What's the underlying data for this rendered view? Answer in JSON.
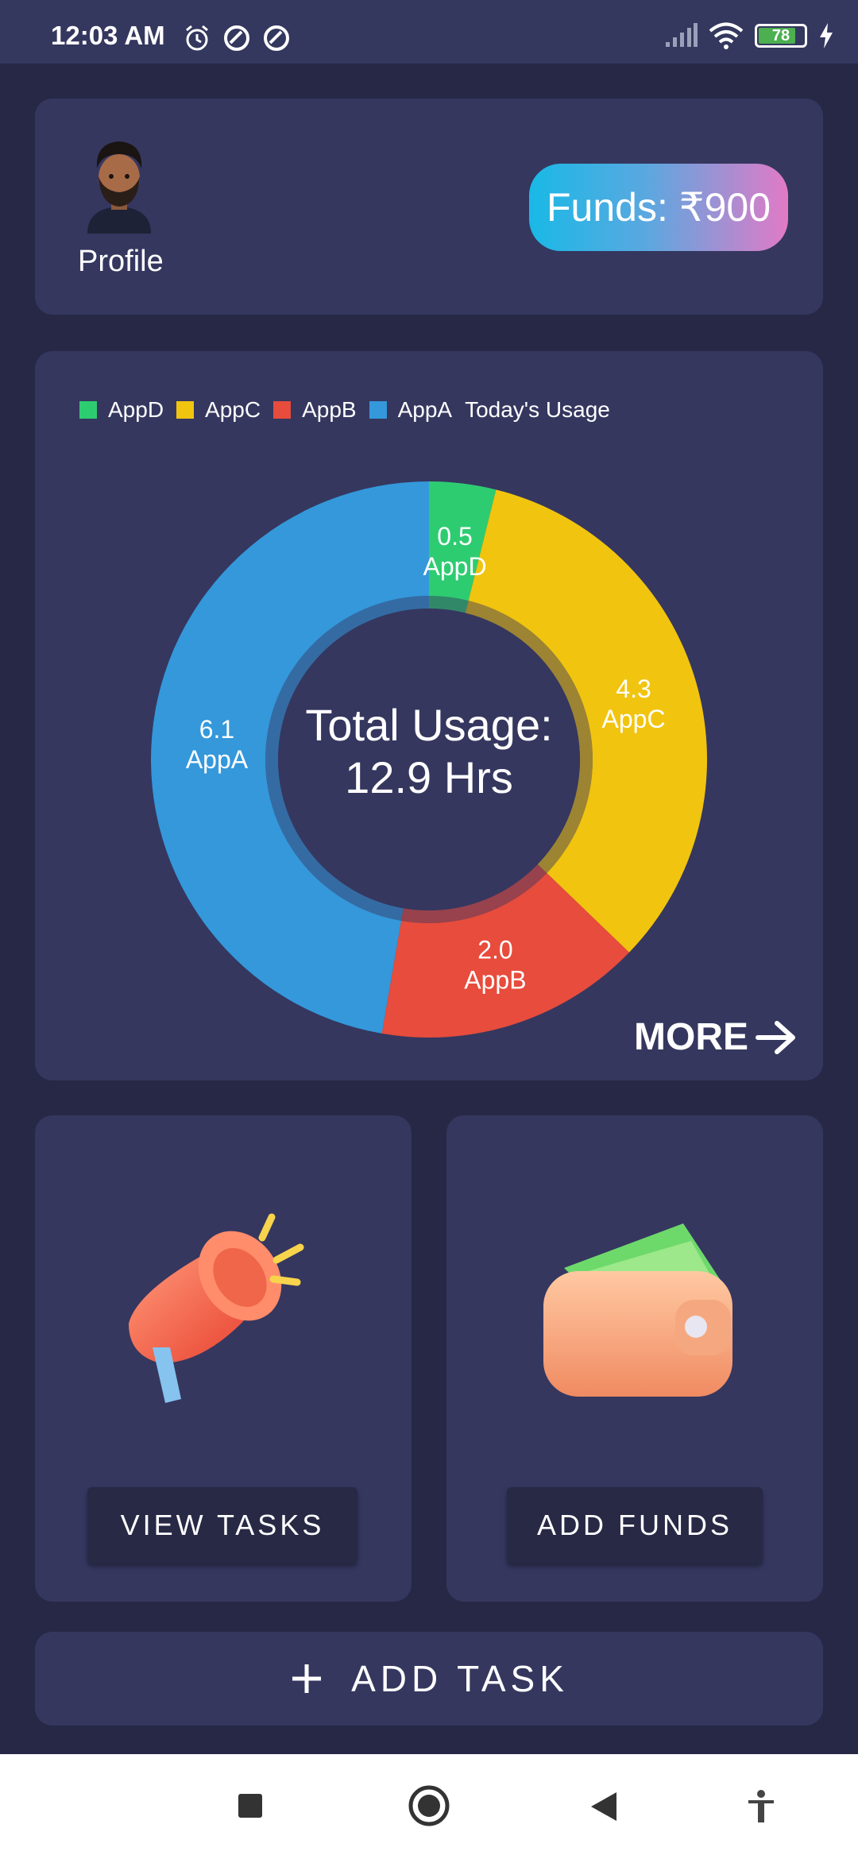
{
  "status_bar": {
    "time": "12:03 AM",
    "battery": "78",
    "icons": [
      "alarm-icon",
      "sync-icon",
      "sync-icon",
      "signal-icon",
      "wifi-icon",
      "battery-icon",
      "charging-icon"
    ]
  },
  "profile": {
    "label": "Profile",
    "funds_label": "Funds: ₹900"
  },
  "usage_card": {
    "more_label": "MORE",
    "center_line1": "Total Usage:",
    "center_line2": "12.9 Hrs"
  },
  "chart_data": {
    "type": "pie",
    "legend_title": "Today's Usage",
    "legend": [
      "AppD",
      "AppC",
      "AppB",
      "AppA"
    ],
    "slices": [
      {
        "label": "AppD",
        "value": 0.5,
        "color": "#2ecc71"
      },
      {
        "label": "AppC",
        "value": 4.3,
        "color": "#f1c40f"
      },
      {
        "label": "AppB",
        "value": 2.0,
        "color": "#e74c3c"
      },
      {
        "label": "AppA",
        "value": 6.1,
        "color": "#3498db"
      }
    ]
  },
  "tiles": {
    "view_tasks_label": "VIEW TASKS",
    "add_funds_label": "ADD FUNDS"
  },
  "add_task": {
    "label": "ADD TASK"
  },
  "nav": {
    "icons": [
      "recents-icon",
      "home-icon",
      "back-icon",
      "accessibility-icon"
    ]
  }
}
